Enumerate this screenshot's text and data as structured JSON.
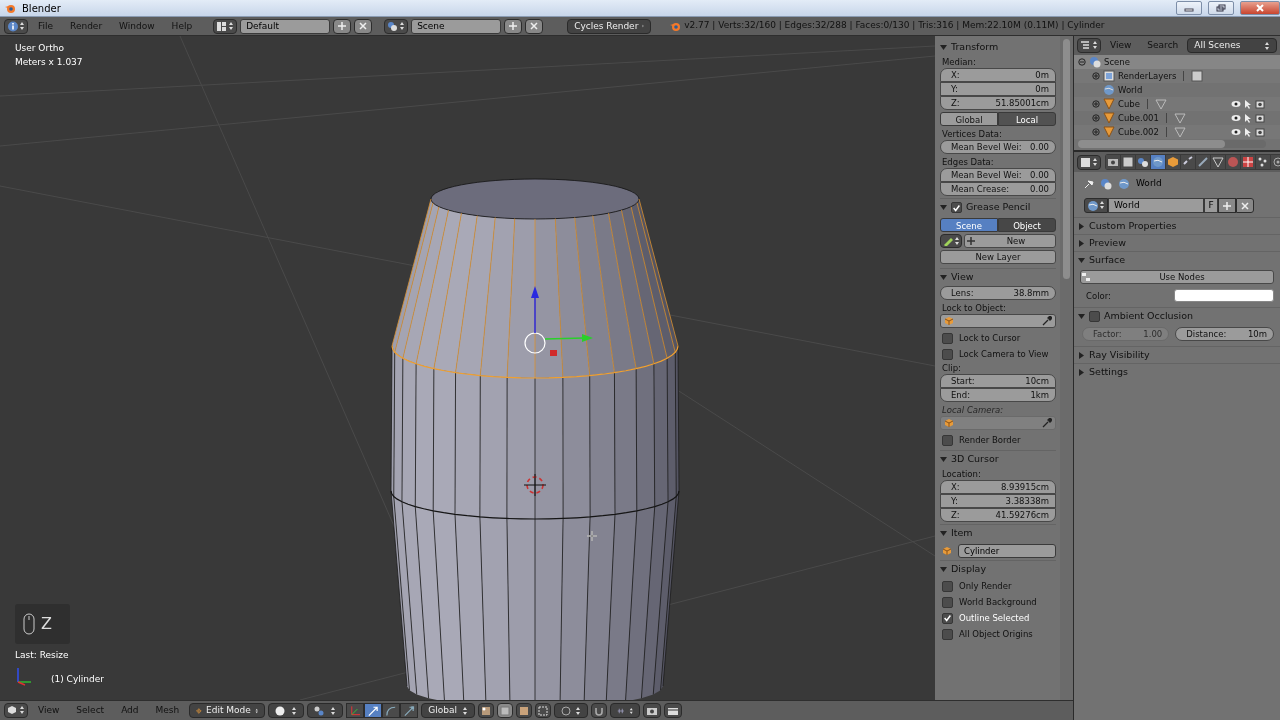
{
  "window": {
    "title": "Blender"
  },
  "info_header": {
    "menus": [
      "File",
      "Render",
      "Window",
      "Help"
    ],
    "screen_layout": "Default",
    "scene": "Scene",
    "render_engine": "Cycles Render",
    "stats": "v2.77 | Verts:32/160 | Edges:32/288 | Faces:0/130 | Tris:316 | Mem:22.10M (0.11M) | Cylinder"
  },
  "viewport": {
    "view_name": "User Ortho",
    "units": "Meters x 1.037",
    "key_hint": "Z",
    "last_operator": "Last: Resize",
    "object_name": "(1) Cylinder"
  },
  "view3d_header": {
    "menus": [
      "View",
      "Select",
      "Add",
      "Mesh"
    ],
    "mode": "Edit Mode",
    "orientation": "Global",
    "manipulators": [
      {
        "kind": "axes",
        "selected": false
      },
      {
        "kind": "translate",
        "selected": true
      },
      {
        "kind": "rotate",
        "selected": false
      },
      {
        "kind": "scale",
        "selected": false
      }
    ]
  },
  "n_panel": {
    "panels": [
      {
        "title": "Transform",
        "expanded": true,
        "rows": [
          {
            "kind": "label",
            "label": "Median:"
          },
          {
            "kind": "fields",
            "fields": [
              {
                "label": "X:",
                "value": "0m"
              },
              {
                "label": "Y:",
                "value": "0m"
              },
              {
                "label": "Z:",
                "value": "51.85001cm"
              }
            ]
          },
          {
            "kind": "toggle",
            "options": [
              {
                "label": "Global",
                "selected": true
              },
              {
                "label": "Local",
                "selected": false
              }
            ]
          },
          {
            "kind": "label",
            "label": "Vertices Data:"
          },
          {
            "kind": "fields",
            "fields": [
              {
                "label": "Mean Bevel Wei:",
                "value": "0.00"
              }
            ]
          },
          {
            "kind": "label",
            "label": "Edges Data:"
          },
          {
            "kind": "fields",
            "fields": [
              {
                "label": "Mean Bevel Wei:",
                "value": "0.00"
              },
              {
                "label": "Mean Crease:",
                "value": "0.00"
              }
            ]
          }
        ]
      },
      {
        "title": "Grease Pencil",
        "expanded": true,
        "checked": true,
        "rows": [
          {
            "kind": "radio",
            "options": [
              {
                "label": "Scene",
                "selected": true
              },
              {
                "label": "Object",
                "selected": false
              }
            ]
          },
          {
            "kind": "new",
            "label": "New"
          },
          {
            "kind": "button",
            "label": "New Layer"
          }
        ]
      },
      {
        "title": "View",
        "expanded": true,
        "rows": [
          {
            "kind": "fields",
            "fields": [
              {
                "label": "Lens:",
                "value": "38.8mm"
              }
            ]
          },
          {
            "kind": "label",
            "label": "Lock to Object:"
          },
          {
            "kind": "object",
            "disabled": false
          },
          {
            "kind": "checkbox",
            "label": "Lock to Cursor",
            "checked": false
          },
          {
            "kind": "checkbox",
            "label": "Lock Camera to View",
            "checked": false
          },
          {
            "kind": "label",
            "label": "Clip:"
          },
          {
            "kind": "fields",
            "fields": [
              {
                "label": "Start:",
                "value": "10cm"
              },
              {
                "label": "End:",
                "value": "1km"
              }
            ]
          },
          {
            "kind": "label",
            "label": "Local Camera:",
            "disabled": true
          },
          {
            "kind": "object",
            "disabled": true
          },
          {
            "kind": "checkbox",
            "label": "Render Border",
            "checked": false
          }
        ]
      },
      {
        "title": "3D Cursor",
        "expanded": true,
        "rows": [
          {
            "kind": "label",
            "label": "Location:"
          },
          {
            "kind": "fields",
            "fields": [
              {
                "label": "X:",
                "value": "8.93915cm"
              },
              {
                "label": "Y:",
                "value": "3.38338m"
              },
              {
                "label": "Z:",
                "value": "41.59276cm"
              }
            ]
          }
        ]
      },
      {
        "title": "Item",
        "expanded": true,
        "rows": [
          {
            "kind": "name",
            "value": "Cylinder"
          }
        ]
      },
      {
        "title": "Display",
        "expanded": true,
        "rows": [
          {
            "kind": "checkbox",
            "label": "Only Render",
            "checked": false
          },
          {
            "kind": "checkbox",
            "label": "World Background",
            "checked": false
          },
          {
            "kind": "checkbox",
            "label": "Outline Selected",
            "checked": true
          },
          {
            "kind": "checkbox",
            "label": "All Object Origins",
            "checked": false
          }
        ]
      }
    ]
  },
  "outliner": {
    "menus": [
      "View",
      "Search"
    ],
    "filter": "All Scenes",
    "items": [
      {
        "label": "Scene",
        "kind": "scene",
        "expanded": true,
        "selected": true,
        "children": [
          {
            "label": "RenderLayers",
            "kind": "renderlayers",
            "expanded": false
          },
          {
            "label": "World",
            "kind": "world"
          },
          {
            "label": "Cube",
            "kind": "mesh",
            "expanded": false
          },
          {
            "label": "Cube.001",
            "kind": "mesh",
            "expanded": false
          },
          {
            "label": "Cube.002",
            "kind": "mesh",
            "expanded": false
          }
        ]
      }
    ]
  },
  "properties": {
    "tabs": [
      {
        "kind": "render",
        "selected": false
      },
      {
        "kind": "render_layers",
        "selected": false
      },
      {
        "kind": "scene",
        "selected": false
      },
      {
        "kind": "world",
        "selected": true
      },
      {
        "kind": "object",
        "selected": false
      },
      {
        "kind": "constraints",
        "selected": false
      },
      {
        "kind": "modifiers",
        "selected": false
      },
      {
        "kind": "data",
        "selected": false
      },
      {
        "kind": "material",
        "selected": false
      },
      {
        "kind": "texture",
        "selected": false
      },
      {
        "kind": "particles",
        "selected": false
      },
      {
        "kind": "physics",
        "selected": false
      }
    ],
    "breadcrumb": "World",
    "datablock": "World",
    "fake_user": "F",
    "panels": [
      {
        "title": "Custom Properties",
        "expanded": false
      },
      {
        "title": "Preview",
        "expanded": false
      },
      {
        "title": "Surface",
        "expanded": true,
        "rows": [
          {
            "kind": "button",
            "label": "Use Nodes"
          },
          {
            "kind": "color",
            "label": "Color:"
          }
        ]
      },
      {
        "title": "Ambient Occlusion",
        "expanded": true,
        "checked": false,
        "rows": [
          {
            "kind": "pair",
            "fields": [
              {
                "label": "Factor:",
                "value": "1.00",
                "disabled": true
              },
              {
                "label": "Distance:",
                "value": "10m",
                "disabled": false
              }
            ]
          }
        ]
      },
      {
        "title": "Ray Visibility",
        "expanded": false
      },
      {
        "title": "Settings",
        "expanded": false
      }
    ]
  }
}
